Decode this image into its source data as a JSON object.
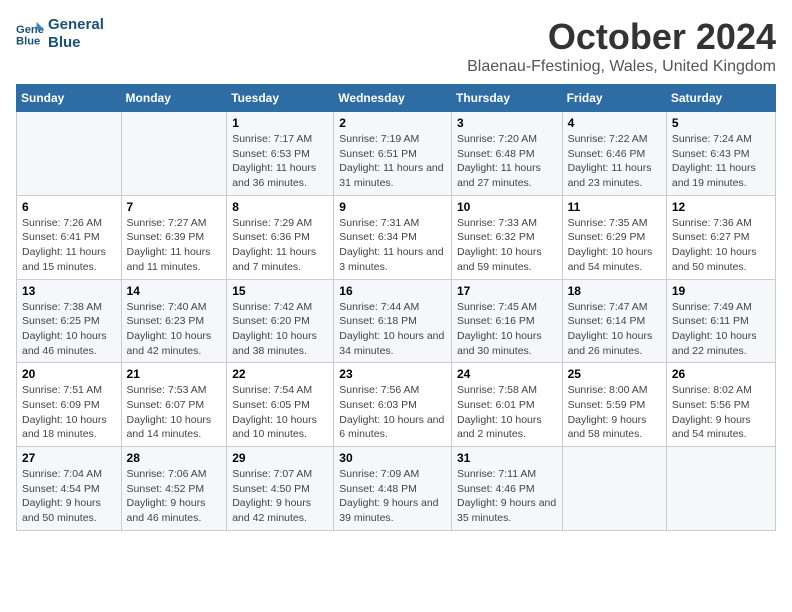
{
  "logo": {
    "line1": "General",
    "line2": "Blue"
  },
  "title": "October 2024",
  "subtitle": "Blaenau-Ffestiniog, Wales, United Kingdom",
  "days_of_week": [
    "Sunday",
    "Monday",
    "Tuesday",
    "Wednesday",
    "Thursday",
    "Friday",
    "Saturday"
  ],
  "weeks": [
    [
      {
        "day": "",
        "detail": ""
      },
      {
        "day": "",
        "detail": ""
      },
      {
        "day": "1",
        "detail": "Sunrise: 7:17 AM\nSunset: 6:53 PM\nDaylight: 11 hours and 36 minutes."
      },
      {
        "day": "2",
        "detail": "Sunrise: 7:19 AM\nSunset: 6:51 PM\nDaylight: 11 hours and 31 minutes."
      },
      {
        "day": "3",
        "detail": "Sunrise: 7:20 AM\nSunset: 6:48 PM\nDaylight: 11 hours and 27 minutes."
      },
      {
        "day": "4",
        "detail": "Sunrise: 7:22 AM\nSunset: 6:46 PM\nDaylight: 11 hours and 23 minutes."
      },
      {
        "day": "5",
        "detail": "Sunrise: 7:24 AM\nSunset: 6:43 PM\nDaylight: 11 hours and 19 minutes."
      }
    ],
    [
      {
        "day": "6",
        "detail": "Sunrise: 7:26 AM\nSunset: 6:41 PM\nDaylight: 11 hours and 15 minutes."
      },
      {
        "day": "7",
        "detail": "Sunrise: 7:27 AM\nSunset: 6:39 PM\nDaylight: 11 hours and 11 minutes."
      },
      {
        "day": "8",
        "detail": "Sunrise: 7:29 AM\nSunset: 6:36 PM\nDaylight: 11 hours and 7 minutes."
      },
      {
        "day": "9",
        "detail": "Sunrise: 7:31 AM\nSunset: 6:34 PM\nDaylight: 11 hours and 3 minutes."
      },
      {
        "day": "10",
        "detail": "Sunrise: 7:33 AM\nSunset: 6:32 PM\nDaylight: 10 hours and 59 minutes."
      },
      {
        "day": "11",
        "detail": "Sunrise: 7:35 AM\nSunset: 6:29 PM\nDaylight: 10 hours and 54 minutes."
      },
      {
        "day": "12",
        "detail": "Sunrise: 7:36 AM\nSunset: 6:27 PM\nDaylight: 10 hours and 50 minutes."
      }
    ],
    [
      {
        "day": "13",
        "detail": "Sunrise: 7:38 AM\nSunset: 6:25 PM\nDaylight: 10 hours and 46 minutes."
      },
      {
        "day": "14",
        "detail": "Sunrise: 7:40 AM\nSunset: 6:23 PM\nDaylight: 10 hours and 42 minutes."
      },
      {
        "day": "15",
        "detail": "Sunrise: 7:42 AM\nSunset: 6:20 PM\nDaylight: 10 hours and 38 minutes."
      },
      {
        "day": "16",
        "detail": "Sunrise: 7:44 AM\nSunset: 6:18 PM\nDaylight: 10 hours and 34 minutes."
      },
      {
        "day": "17",
        "detail": "Sunrise: 7:45 AM\nSunset: 6:16 PM\nDaylight: 10 hours and 30 minutes."
      },
      {
        "day": "18",
        "detail": "Sunrise: 7:47 AM\nSunset: 6:14 PM\nDaylight: 10 hours and 26 minutes."
      },
      {
        "day": "19",
        "detail": "Sunrise: 7:49 AM\nSunset: 6:11 PM\nDaylight: 10 hours and 22 minutes."
      }
    ],
    [
      {
        "day": "20",
        "detail": "Sunrise: 7:51 AM\nSunset: 6:09 PM\nDaylight: 10 hours and 18 minutes."
      },
      {
        "day": "21",
        "detail": "Sunrise: 7:53 AM\nSunset: 6:07 PM\nDaylight: 10 hours and 14 minutes."
      },
      {
        "day": "22",
        "detail": "Sunrise: 7:54 AM\nSunset: 6:05 PM\nDaylight: 10 hours and 10 minutes."
      },
      {
        "day": "23",
        "detail": "Sunrise: 7:56 AM\nSunset: 6:03 PM\nDaylight: 10 hours and 6 minutes."
      },
      {
        "day": "24",
        "detail": "Sunrise: 7:58 AM\nSunset: 6:01 PM\nDaylight: 10 hours and 2 minutes."
      },
      {
        "day": "25",
        "detail": "Sunrise: 8:00 AM\nSunset: 5:59 PM\nDaylight: 9 hours and 58 minutes."
      },
      {
        "day": "26",
        "detail": "Sunrise: 8:02 AM\nSunset: 5:56 PM\nDaylight: 9 hours and 54 minutes."
      }
    ],
    [
      {
        "day": "27",
        "detail": "Sunrise: 7:04 AM\nSunset: 4:54 PM\nDaylight: 9 hours and 50 minutes."
      },
      {
        "day": "28",
        "detail": "Sunrise: 7:06 AM\nSunset: 4:52 PM\nDaylight: 9 hours and 46 minutes."
      },
      {
        "day": "29",
        "detail": "Sunrise: 7:07 AM\nSunset: 4:50 PM\nDaylight: 9 hours and 42 minutes."
      },
      {
        "day": "30",
        "detail": "Sunrise: 7:09 AM\nSunset: 4:48 PM\nDaylight: 9 hours and 39 minutes."
      },
      {
        "day": "31",
        "detail": "Sunrise: 7:11 AM\nSunset: 4:46 PM\nDaylight: 9 hours and 35 minutes."
      },
      {
        "day": "",
        "detail": ""
      },
      {
        "day": "",
        "detail": ""
      }
    ]
  ]
}
